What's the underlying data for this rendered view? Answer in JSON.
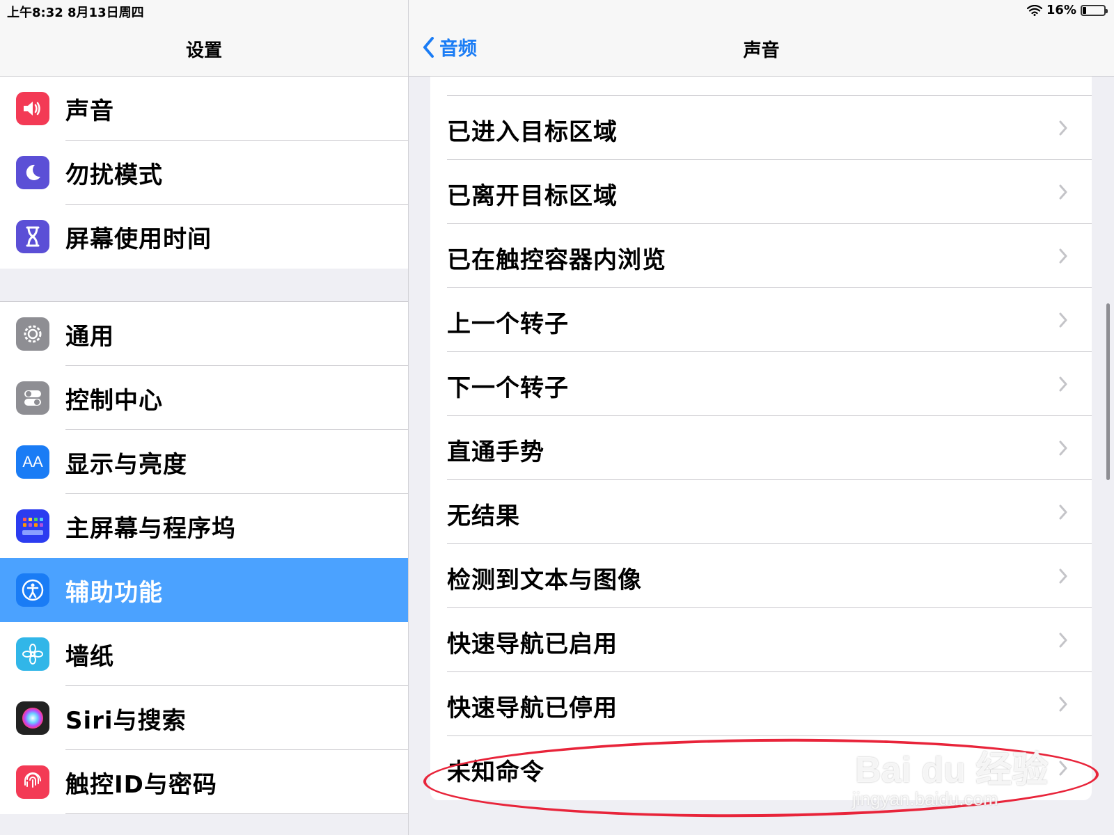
{
  "status": {
    "time": "上午8:32   8月13日周四",
    "battery_percent": "16%"
  },
  "left": {
    "title": "设置",
    "group1": [
      {
        "label": "声音",
        "icon": "speaker-icon",
        "color": "#f33a55"
      },
      {
        "label": "勿扰模式",
        "icon": "moon-icon",
        "color": "#5b4fd6"
      },
      {
        "label": "屏幕使用时间",
        "icon": "hourglass-icon",
        "color": "#5b4fd6"
      }
    ],
    "group2": [
      {
        "label": "通用",
        "icon": "gear-icon",
        "color": "#8e8e93"
      },
      {
        "label": "控制中心",
        "icon": "toggles-icon",
        "color": "#8e8e93"
      },
      {
        "label": "显示与亮度",
        "icon": "text-size-icon",
        "color": "#1a7cf5",
        "glyph": "AA"
      },
      {
        "label": "主屏幕与程序坞",
        "icon": "home-grid-icon",
        "color": "#2b3cf0"
      },
      {
        "label": "辅助功能",
        "icon": "accessibility-icon",
        "color": "#1a7cf5",
        "selected": true
      },
      {
        "label": "墙纸",
        "icon": "flower-icon",
        "color": "#31b6e8"
      },
      {
        "label": "Siri与搜索",
        "icon": "siri-icon",
        "color": "#222222"
      },
      {
        "label": "触控ID与密码",
        "icon": "fingerprint-icon",
        "color": "#f33a55"
      }
    ]
  },
  "right": {
    "back_label": "音频",
    "title": "声音",
    "items": [
      "已进入目标区域",
      "已离开目标区域",
      "已在触控容器内浏览",
      "上一个转子",
      "下一个转子",
      "直通手势",
      "无结果",
      "检测到文本与图像",
      "快速导航已启用",
      "快速导航已停用",
      "未知命令"
    ]
  },
  "watermark": {
    "main": "Bai du 经验",
    "sub": "jingyan.baidu.com"
  }
}
